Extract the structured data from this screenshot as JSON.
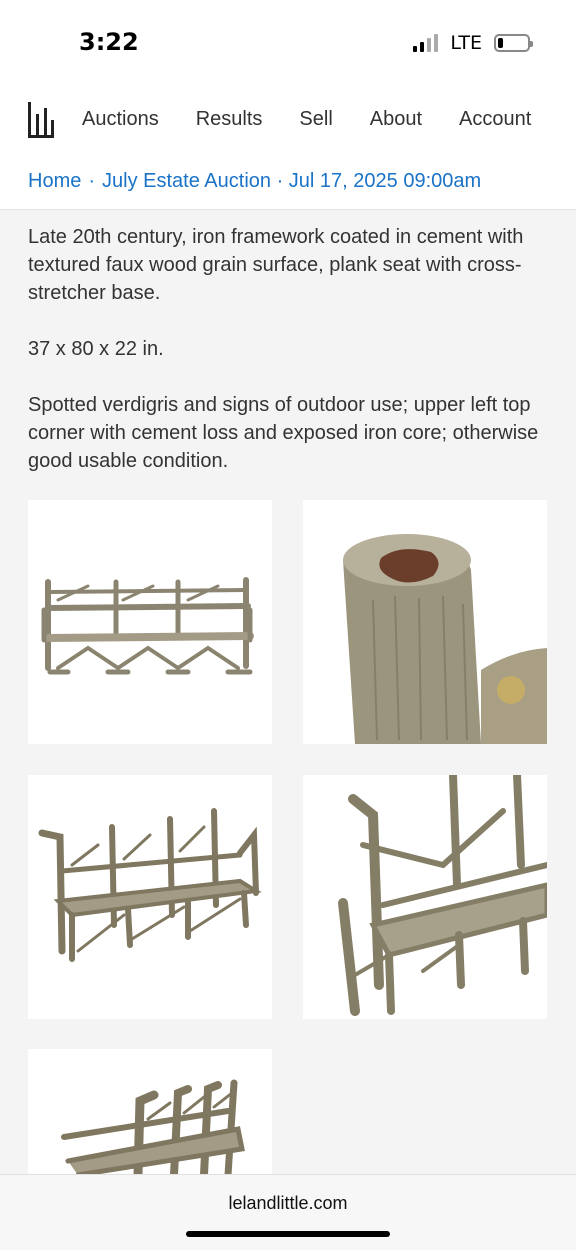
{
  "status": {
    "time": "3:22",
    "network": "LTE"
  },
  "nav": {
    "items": [
      "Auctions",
      "Results",
      "Sell",
      "About",
      "Account"
    ]
  },
  "breadcrumb": {
    "home": "Home",
    "separator": "·",
    "auction": "July Estate Auction · Jul 17, 2025 09:00am"
  },
  "description": {
    "paragraphs": [
      "Late 20th century, iron framework coated in cement with textured faux wood grain surface, plank seat with cross-stretcher base.",
      "37 x 80 x 22 in.",
      "Spotted verdigris and signs of outdoor use; upper left top corner with cement loss and exposed iron core; otherwise good usable condition."
    ]
  },
  "browser": {
    "url": "lelandlittle.com"
  },
  "colors": {
    "link": "#1a73c8",
    "background": "#f4f4f4",
    "faux_bois": "#8b8470"
  }
}
